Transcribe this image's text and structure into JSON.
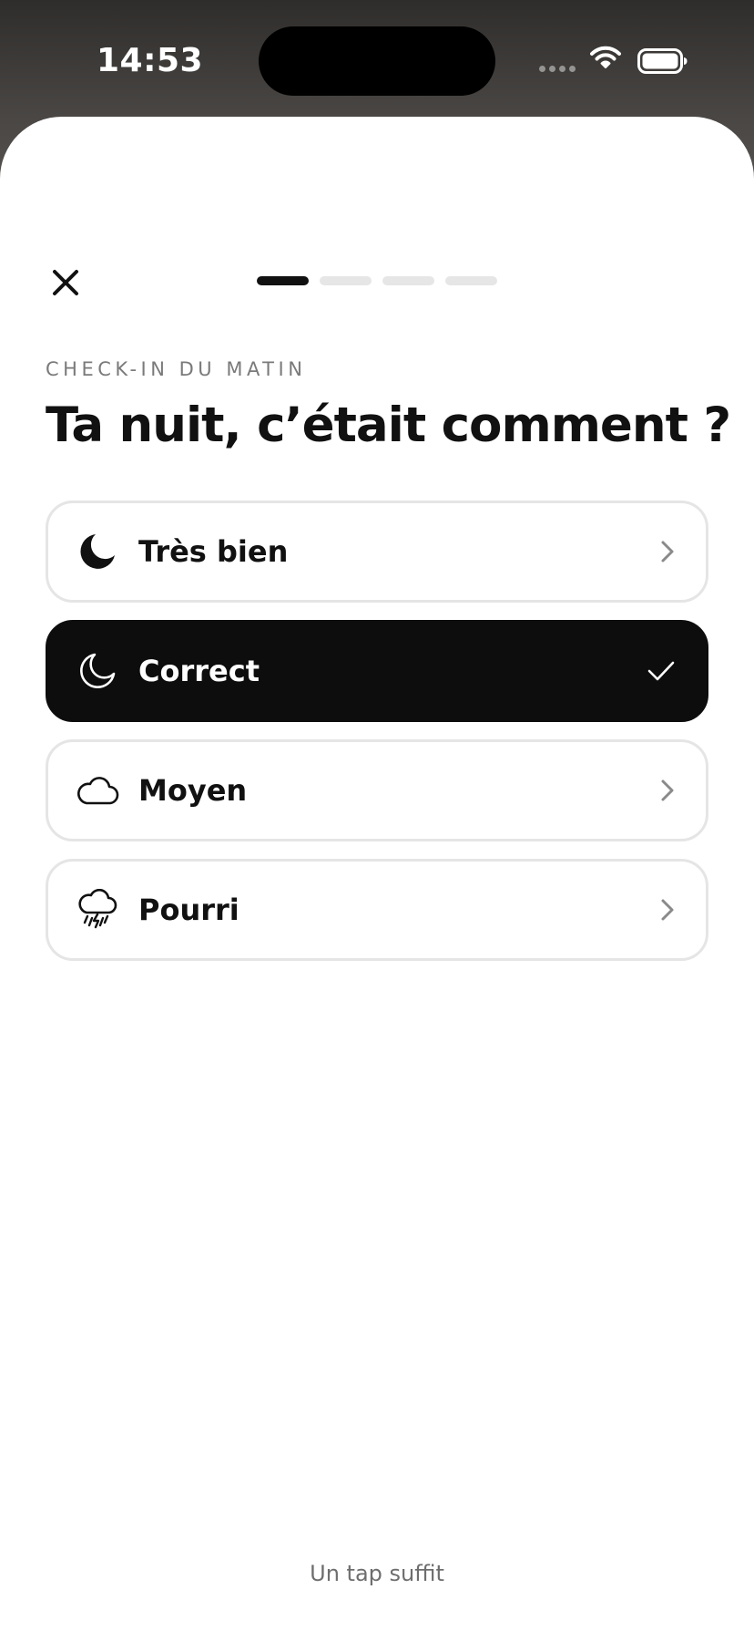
{
  "status_bar": {
    "time": "14:53",
    "signal_icon": "cellular-signal-icon",
    "wifi_icon": "wifi-icon",
    "battery_icon": "battery-icon"
  },
  "header": {
    "close_icon": "close-icon",
    "progress": {
      "current_step": 1,
      "total_steps": 4
    }
  },
  "content": {
    "eyebrow": "CHECK-IN DU MATIN",
    "title": "Ta nuit, c’était comment ?"
  },
  "options": [
    {
      "label": "Très bien",
      "icon": "moon-filled-icon",
      "selected": false,
      "trailing_icon": "chevron-right-icon"
    },
    {
      "label": "Correct",
      "icon": "moon-outline-icon",
      "selected": true,
      "trailing_icon": "checkmark-icon"
    },
    {
      "label": "Moyen",
      "icon": "cloud-icon",
      "selected": false,
      "trailing_icon": "chevron-right-icon"
    },
    {
      "label": "Pourri",
      "icon": "cloud-storm-icon",
      "selected": false,
      "trailing_icon": "chevron-right-icon"
    }
  ],
  "footer": {
    "hint": "Un tap suffit"
  },
  "colors": {
    "accent": "#0d0d0d",
    "border": "#e5e5e5",
    "progress_inactive": "#e6e6e6",
    "muted_text": "#7a7a7a"
  }
}
